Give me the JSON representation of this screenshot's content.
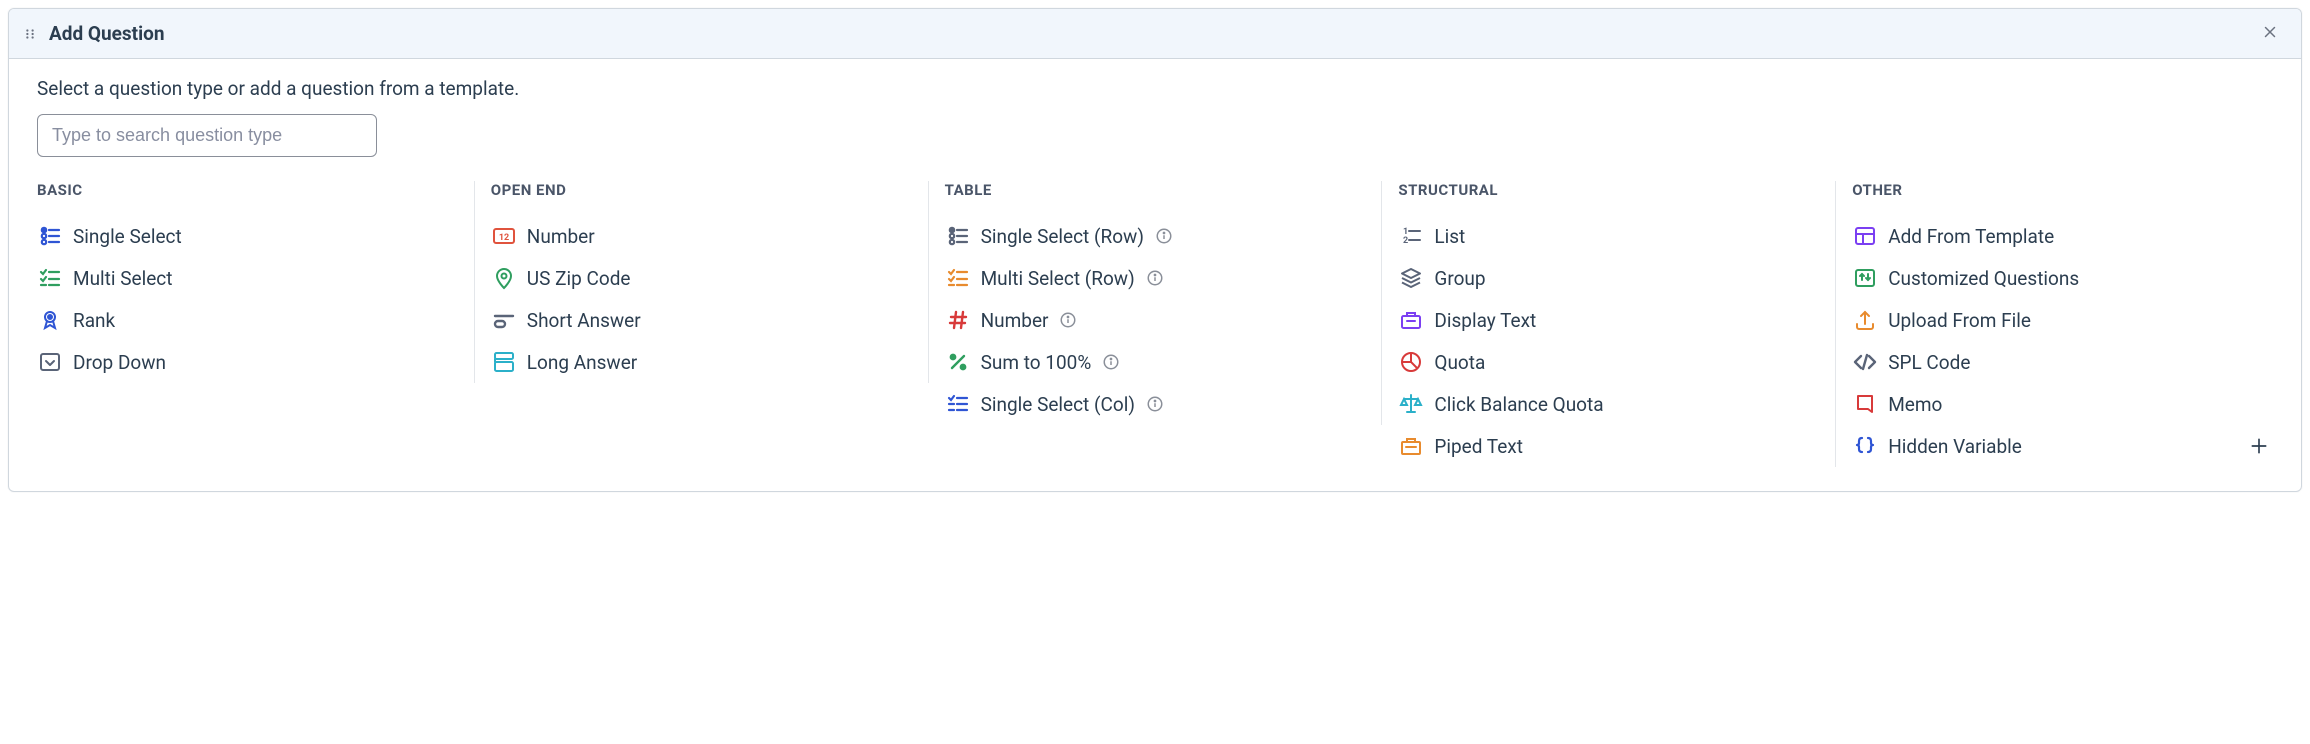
{
  "header": {
    "title": "Add Question"
  },
  "subtitle": "Select a question type or add a question from a template.",
  "search": {
    "placeholder": "Type to search question type"
  },
  "columns": [
    {
      "title": "BASIC",
      "items": [
        {
          "label": "Single Select",
          "icon": "single-select-icon",
          "info": false
        },
        {
          "label": "Multi Select",
          "icon": "multi-select-icon",
          "info": false
        },
        {
          "label": "Rank",
          "icon": "rank-icon",
          "info": false
        },
        {
          "label": "Drop Down",
          "icon": "dropdown-icon",
          "info": false
        }
      ]
    },
    {
      "title": "OPEN END",
      "items": [
        {
          "label": "Number",
          "icon": "number-box-icon",
          "info": false
        },
        {
          "label": "US Zip Code",
          "icon": "zip-icon",
          "info": false
        },
        {
          "label": "Short Answer",
          "icon": "short-answer-icon",
          "info": false
        },
        {
          "label": "Long Answer",
          "icon": "long-answer-icon",
          "info": false
        }
      ]
    },
    {
      "title": "TABLE",
      "items": [
        {
          "label": "Single Select (Row)",
          "icon": "single-select-row-icon",
          "info": true
        },
        {
          "label": "Multi Select (Row)",
          "icon": "multi-select-row-icon",
          "info": true
        },
        {
          "label": "Number",
          "icon": "hash-icon",
          "info": true
        },
        {
          "label": "Sum to 100%",
          "icon": "percent-icon",
          "info": true
        },
        {
          "label": "Single Select (Col)",
          "icon": "single-select-col-icon",
          "info": true
        }
      ]
    },
    {
      "title": "STRUCTURAL",
      "items": [
        {
          "label": "List",
          "icon": "list-num-icon",
          "info": false
        },
        {
          "label": "Group",
          "icon": "group-icon",
          "info": false
        },
        {
          "label": "Display Text",
          "icon": "display-text-icon",
          "info": false
        },
        {
          "label": "Quota",
          "icon": "quota-icon",
          "info": false
        },
        {
          "label": "Click Balance Quota",
          "icon": "balance-icon",
          "info": false
        },
        {
          "label": "Piped Text",
          "icon": "piped-icon",
          "info": false
        }
      ]
    },
    {
      "title": "OTHER",
      "items": [
        {
          "label": "Add From Template",
          "icon": "template-icon",
          "info": false
        },
        {
          "label": "Customized Questions",
          "icon": "customized-icon",
          "info": false
        },
        {
          "label": "Upload From File",
          "icon": "upload-icon",
          "info": false
        },
        {
          "label": "SPL Code",
          "icon": "code-icon",
          "info": false
        },
        {
          "label": "Memo",
          "icon": "memo-icon",
          "info": false
        },
        {
          "label": "Hidden Variable",
          "icon": "braces-icon",
          "info": false
        }
      ]
    }
  ]
}
